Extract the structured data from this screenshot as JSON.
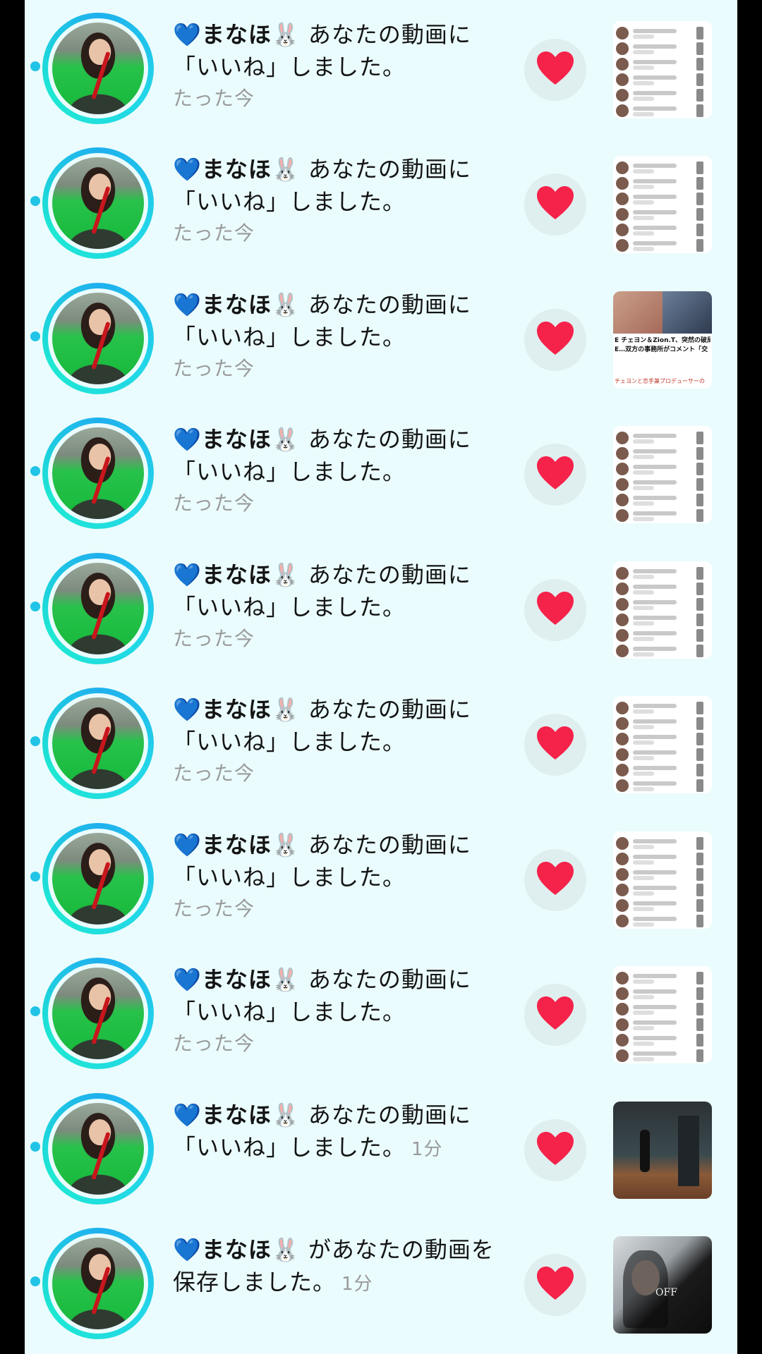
{
  "notifications": [
    {
      "user_prefix": "💙",
      "name": "まなほ",
      "user_suffix": "🐰",
      "text": " あなたの動画に「いいね」しました。",
      "time": "たった今",
      "time_inline": false,
      "thumb": "list"
    },
    {
      "user_prefix": "💙",
      "name": "まなほ",
      "user_suffix": "🐰",
      "text": " あなたの動画に「いいね」しました。",
      "time": "たった今",
      "time_inline": false,
      "thumb": "list"
    },
    {
      "user_prefix": "💙",
      "name": "まなほ",
      "user_suffix": "🐰",
      "text": " あなたの動画に「いいね」しました。",
      "time": "たった今",
      "time_inline": false,
      "thumb": "news",
      "thumb_text_1": "E チェヨン＆Zion.T、突然の破局",
      "thumb_text_2": "E…双方の事務所がコメント「交",
      "thumb_text_3": "チェヨンと恋手兼プロデューサーの"
    },
    {
      "user_prefix": "💙",
      "name": "まなほ",
      "user_suffix": "🐰",
      "text": " あなたの動画に「いいね」しました。",
      "time": "たった今",
      "time_inline": false,
      "thumb": "list"
    },
    {
      "user_prefix": "💙",
      "name": "まなほ",
      "user_suffix": "🐰",
      "text": " あなたの動画に「いいね」しました。",
      "time": "たった今",
      "time_inline": false,
      "thumb": "list"
    },
    {
      "user_prefix": "💙",
      "name": "まなほ",
      "user_suffix": "🐰",
      "text": " あなたの動画に「いいね」しました。",
      "time": "たった今",
      "time_inline": false,
      "thumb": "list"
    },
    {
      "user_prefix": "💙",
      "name": "まなほ",
      "user_suffix": "🐰",
      "text": " あなたの動画に「いいね」しました。",
      "time": "たった今",
      "time_inline": false,
      "thumb": "list"
    },
    {
      "user_prefix": "💙",
      "name": "まなほ",
      "user_suffix": "🐰",
      "text": " あなたの動画に「いいね」しました。",
      "time": "たった今",
      "time_inline": false,
      "thumb": "list"
    },
    {
      "user_prefix": "💙",
      "name": "まなほ",
      "user_suffix": "🐰",
      "text": " あなたの動画に「いいね」しました。",
      "time": "1分",
      "time_inline": true,
      "thumb": "video-hall"
    },
    {
      "user_prefix": "💙",
      "name": "まなほ",
      "user_suffix": "🐰",
      "text": " があなたの動画を保存しました。",
      "time": "1分",
      "time_inline": true,
      "thumb": "video-portrait",
      "thumb_text_1": "OFF"
    }
  ],
  "colors": {
    "background": "#eafcfd",
    "heart_red": "#f5224a",
    "heart_blue": "#3cc7ee",
    "ring": "#22d6e8"
  },
  "icons": {
    "like": "heart-icon",
    "unread": "unread-dot"
  }
}
